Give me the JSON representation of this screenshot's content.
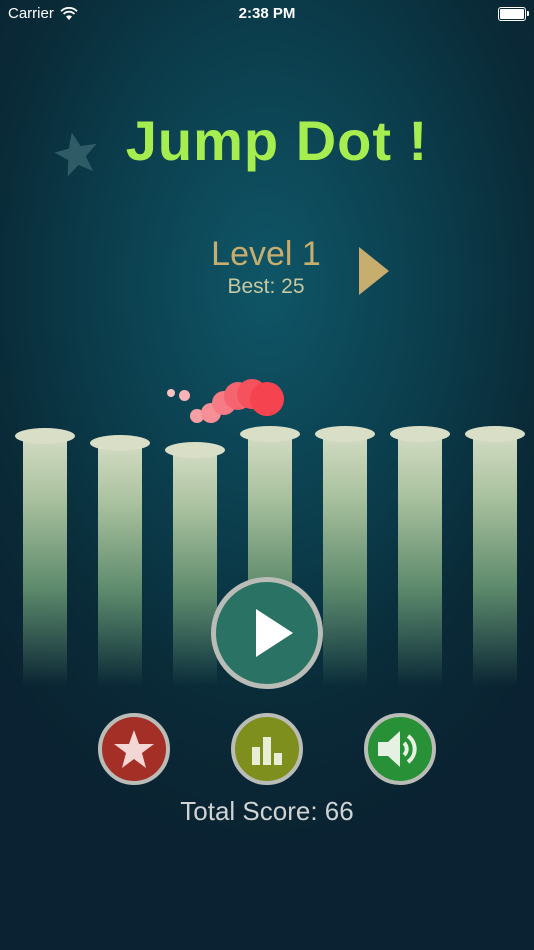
{
  "status_bar": {
    "carrier": "Carrier",
    "time": "2:38 PM"
  },
  "game": {
    "title": "Jump Dot !",
    "level_label": "Level 1",
    "best_label": "Best: 25",
    "total_score_label": "Total Score: 66"
  },
  "icons": {
    "deco": "star-icon",
    "next_level": "triangle-right-icon",
    "play": "play-icon",
    "rate": "star-icon",
    "leaderboard": "bar-chart-icon",
    "sound": "speaker-icon"
  },
  "colors": {
    "title": "#a6ee4f",
    "level_text": "#c8ae6e",
    "play_button": "#2a7263",
    "rate_button": "#a32f27",
    "leaderboard_button": "#7f8f1e",
    "sound_button": "#289036",
    "dot": "#f5444f"
  }
}
